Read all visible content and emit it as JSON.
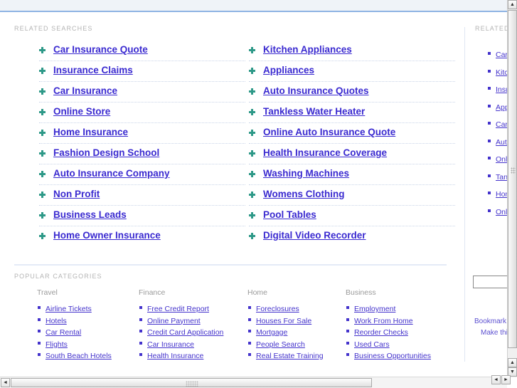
{
  "header": {
    "band_color": "#eff3f8",
    "border_color": "#8eb4e3"
  },
  "main": {
    "related_searches_label": "RELATED SEARCHES",
    "popular_categories_label": "POPULAR CATEGORIES",
    "related_searches": {
      "left_column": [
        "Car Insurance Quote",
        "Insurance Claims",
        "Car Insurance",
        "Online Store",
        "Home Insurance",
        "Fashion Design School",
        "Auto Insurance Company",
        "Non Profit",
        "Business Leads",
        "Home Owner Insurance"
      ],
      "right_column": [
        "Kitchen Appliances",
        "Appliances",
        "Auto Insurance Quotes",
        "Tankless Water Heater",
        "Online Auto Insurance Quote",
        "Health Insurance Coverage",
        "Washing Machines",
        "Womens Clothing",
        "Pool Tables",
        "Digital Video Recorder"
      ]
    },
    "popular_categories": [
      {
        "heading": "Travel",
        "items": [
          "Airline Tickets",
          "Hotels",
          "Car Rental",
          "Flights",
          "South Beach Hotels"
        ]
      },
      {
        "heading": "Finance",
        "items": [
          "Free Credit Report",
          "Online Payment",
          "Credit Card Application",
          "Car Insurance",
          "Health Insurance"
        ]
      },
      {
        "heading": "Home",
        "items": [
          "Foreclosures",
          "Houses For Sale",
          "Mortgage",
          "People Search",
          "Real Estate Training"
        ]
      },
      {
        "heading": "Business",
        "items": [
          "Employment",
          "Work From Home",
          "Reorder Checks",
          "Used Cars",
          "Business Opportunities"
        ]
      }
    ]
  },
  "sidebar": {
    "label": "RELATED SEARCHES",
    "items": [
      "Car Insurance Quote",
      "Kitchen Appliances",
      "Insurance Claims",
      "Appliances",
      "Car Insurance",
      "Auto Insurance Quotes",
      "Online Store",
      "Tankless Water Heater",
      "Home Insurance",
      "Online Auto Insurance Quote"
    ],
    "search_value": "",
    "search_placeholder": "",
    "bookmark_label": "Bookmark this page",
    "make_home_label": "Make this my home page"
  },
  "scrollbars": {
    "up_arrow": "▲",
    "down_arrow": "▼",
    "left_arrow": "◄",
    "right_arrow": "►"
  },
  "colors": {
    "link": "#3a2ad0",
    "small_link": "#4433cc",
    "bullet_star": "#2e9988",
    "label_gray": "#b4b4b4",
    "divider": "#c9d4e8"
  }
}
